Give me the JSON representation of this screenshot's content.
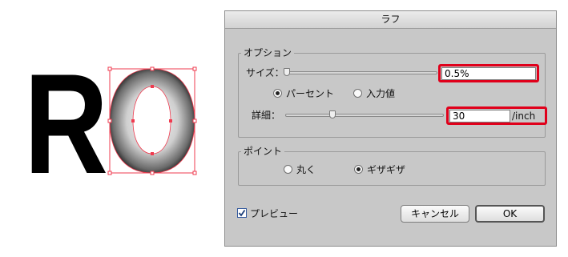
{
  "canvas": {
    "letters": [
      "R",
      "O"
    ]
  },
  "dialog": {
    "title": "ラフ",
    "options_group": {
      "legend": "オプション",
      "size_label": "サイズ：",
      "size_value": "0.5%",
      "unit_radio_percent": "パーセント",
      "unit_radio_absolute": "入力値",
      "unit_selected": "percent",
      "detail_label": "詳細：",
      "detail_value": "30",
      "detail_unit": "/inch"
    },
    "point_group": {
      "legend": "ポイント",
      "radio_round": "丸く",
      "radio_jagged": "ギザギザ",
      "selected": "jagged"
    },
    "preview_label": "プレビュー",
    "preview_checked": true,
    "cancel_label": "キャンセル",
    "ok_label": "OK"
  },
  "colors": {
    "highlight": "#e0001b",
    "selection": "#ef3b4f",
    "dialog_bg": "#c8c8c8"
  }
}
